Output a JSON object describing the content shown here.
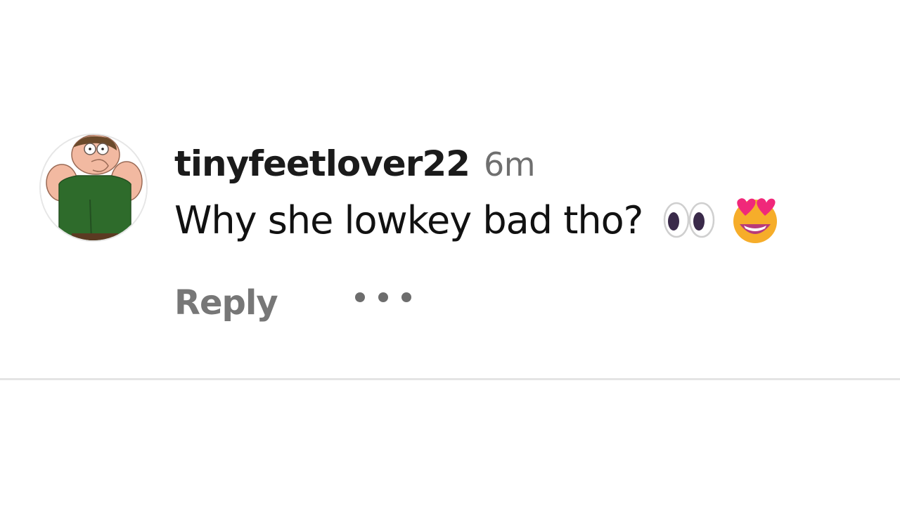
{
  "comment": {
    "username": "tinyfeetlover22",
    "timestamp": "6m",
    "text": "Why she lowkey bad tho?",
    "emojis": [
      "eyes-emoji",
      "heart-eyes-emoji"
    ],
    "avatar": "family-guy-avatar"
  },
  "actions": {
    "reply_label": "Reply",
    "more_icon": "more-dots-icon"
  },
  "colors": {
    "username": "#1b1b1b",
    "timestamp": "#6f6f6f",
    "reply": "#777777",
    "divider": "#e4e4e4"
  }
}
